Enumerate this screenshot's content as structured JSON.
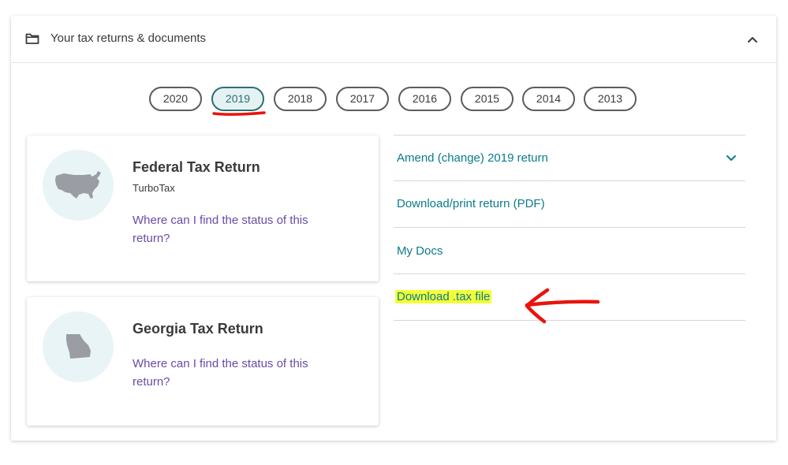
{
  "header": {
    "title": "Your tax returns & documents",
    "folder_icon": "folder-icon",
    "collapse_icon": "chevron-up-icon"
  },
  "years": [
    "2020",
    "2019",
    "2018",
    "2017",
    "2016",
    "2015",
    "2014",
    "2013"
  ],
  "selected_year": "2019",
  "returns": [
    {
      "title": "Federal Tax Return",
      "subtitle": "TurboTax",
      "link": "Where can I find the status of this return?",
      "icon": "usa-map-icon"
    },
    {
      "title": "Georgia Tax Return",
      "link": "Where can I find the status of this return?",
      "icon": "georgia-map-icon"
    }
  ],
  "actions": [
    {
      "label": "Amend (change) 2019 return",
      "icon": "chevron-down-icon"
    },
    {
      "label": "Download/print return (PDF)"
    },
    {
      "label": "My Docs"
    },
    {
      "label": "Download .tax file",
      "highlighted": true
    }
  ],
  "colors": {
    "link_teal": "#0a7b8a",
    "link_purple": "#6b4aa6",
    "selected_pill_bg": "#e4f2f2",
    "highlight_yellow": "#f3ff3a",
    "annotation_red": "#e8140c"
  }
}
